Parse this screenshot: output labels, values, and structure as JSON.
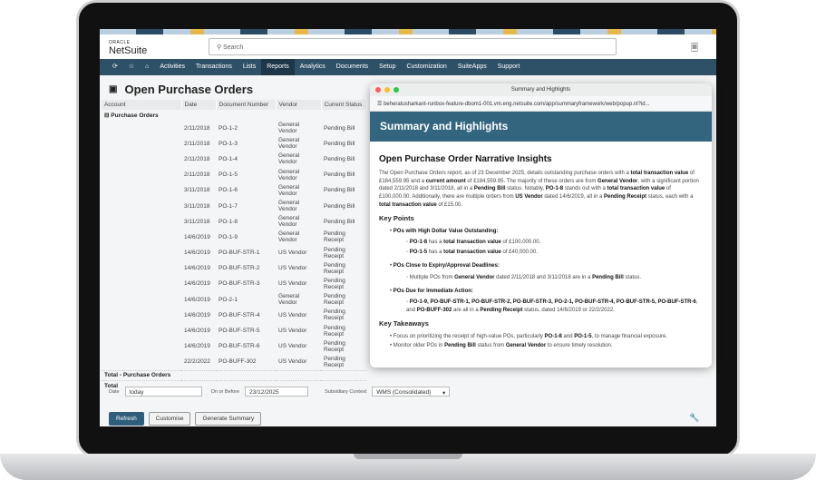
{
  "brand": {
    "top": "ORACLE",
    "name": "NetSuite"
  },
  "search": {
    "placeholder": "Search"
  },
  "nav": {
    "icons": [
      "history-icon",
      "star-icon",
      "home-icon"
    ],
    "items": [
      "Activities",
      "Transactions",
      "Lists",
      "Reports",
      "Analytics",
      "Documents",
      "Setup",
      "Customization",
      "SuiteApps",
      "Support"
    ],
    "active": "Reports"
  },
  "page": {
    "title": "Open Purchase Orders"
  },
  "table": {
    "columns": [
      "Account",
      "Date",
      "Document Number",
      "Vendor",
      "Current Status"
    ],
    "group": "Purchase Orders",
    "rows": [
      [
        "2/11/2018",
        "PO-1-2",
        "General Vendor",
        "Pending Bill"
      ],
      [
        "2/11/2018",
        "PO-1-3",
        "General Vendor",
        "Pending Bill"
      ],
      [
        "2/11/2018",
        "PO-1-4",
        "General Vendor",
        "Pending Bill"
      ],
      [
        "2/11/2018",
        "PO-1-5",
        "General Vendor",
        "Pending Bill"
      ],
      [
        "3/11/2018",
        "PO-1-6",
        "General Vendor",
        "Pending Bill"
      ],
      [
        "3/11/2018",
        "PO-1-7",
        "General Vendor",
        "Pending Bill"
      ],
      [
        "3/11/2018",
        "PO-1-8",
        "General Vendor",
        "Pending Bill"
      ],
      [
        "14/6/2019",
        "PO-1-9",
        "General Vendor",
        "Pending Receipt"
      ],
      [
        "14/6/2019",
        "PO-BUF-STR-1",
        "US Vendor",
        "Pending Receipt"
      ],
      [
        "14/6/2019",
        "PO-BUF-STR-2",
        "US Vendor",
        "Pending Receipt"
      ],
      [
        "14/6/2019",
        "PO-BUF-STR-3",
        "US Vendor",
        "Pending Receipt"
      ],
      [
        "14/6/2019",
        "PO-2-1",
        "General Vendor",
        "Pending Receipt"
      ],
      [
        "14/6/2019",
        "PO-BUF-STR-4",
        "US Vendor",
        "Pending Receipt"
      ],
      [
        "14/6/2019",
        "PO-BUF-STR-5",
        "US Vendor",
        "Pending Receipt"
      ],
      [
        "14/6/2019",
        "PO-BUF-STR-6",
        "US Vendor",
        "Pending Receipt"
      ],
      [
        "22/2/2022",
        "PO-BUFF-302",
        "US Vendor",
        "Pending Receipt"
      ]
    ],
    "group_total": "Total - Purchase Orders",
    "total": "Total"
  },
  "filters": {
    "date_label": "Date",
    "date_value": "today",
    "before_label": "On or Before",
    "before_value": "23/12/2025",
    "subsidiary_label": "Subsidiary Context",
    "subsidiary_value": "WMS (Consolidated)"
  },
  "buttons": {
    "refresh": "Refresh",
    "customise": "Customise",
    "generate": "Generate Summary"
  },
  "popup": {
    "window_title": "Summary and Highlights",
    "url": "beheratusharkant-runbox-feature-dbom1-001.vm.eng.netsuite.com/app/summaryframework/web/popup.nl?id...",
    "banner": "Summary and Highlights",
    "heading": "Open Purchase Order Narrative Insights",
    "intro": [
      {
        "t": "The Open Purchase Orders report, as of 23 December 2025, details outstanding purchase orders with a "
      },
      {
        "t": "total transaction value",
        "b": true
      },
      {
        "t": " of £184,559.95 and a "
      },
      {
        "t": "current amount",
        "b": true
      },
      {
        "t": " of £184,559.95. The majority of these orders are from "
      },
      {
        "t": "General Vendor",
        "b": true
      },
      {
        "t": ", with a significant portion dated 2/11/2018 and 3/11/2018, all in a "
      },
      {
        "t": "Pending Bill",
        "b": true
      },
      {
        "t": " status. Notably, "
      },
      {
        "t": "PO-1-8",
        "b": true
      },
      {
        "t": " stands out with a "
      },
      {
        "t": "total transaction value",
        "b": true
      },
      {
        "t": " of £100,000.00. Additionally, there are multiple orders from "
      },
      {
        "t": "US Vendor",
        "b": true
      },
      {
        "t": " dated 14/6/2019, all in a "
      },
      {
        "t": "Pending Receipt",
        "b": true
      },
      {
        "t": " status, each with a "
      },
      {
        "t": "total transaction value",
        "b": true
      },
      {
        "t": " of £15.00."
      }
    ],
    "key_points_title": "Key Points",
    "key_points": [
      {
        "title": "POs with High Dollar Value Outstanding:",
        "items": [
          [
            {
              "t": "PO-1-8",
              "b": true
            },
            {
              "t": " has a "
            },
            {
              "t": "total transaction value",
              "b": true
            },
            {
              "t": " of £100,000.00."
            }
          ],
          [
            {
              "t": "PO-1-5",
              "b": true
            },
            {
              "t": " has a "
            },
            {
              "t": "total transaction value",
              "b": true
            },
            {
              "t": " of £40,000.00."
            }
          ]
        ]
      },
      {
        "title": "POs Close to Expiry/Approval Deadlines:",
        "items": [
          [
            {
              "t": "Multiple POs from "
            },
            {
              "t": "General Vendor",
              "b": true
            },
            {
              "t": " dated 2/11/2018 and 3/11/2018 are in a "
            },
            {
              "t": "Pending Bill",
              "b": true
            },
            {
              "t": " status."
            }
          ]
        ]
      },
      {
        "title": "POs Due for Immediate Action:",
        "items": [
          [
            {
              "t": "PO-1-9, PO-BUF-STR-1, PO-BUF-STR-2, PO-BUF-STR-3, PO-2-1, PO-BUF-STR-4, PO-BUF-STR-5, PO-BUF-STR-6",
              "b": true
            },
            {
              "t": ", and "
            },
            {
              "t": "PO-BUFF-302",
              "b": true
            },
            {
              "t": " are all in a "
            },
            {
              "t": "Pending Receipt",
              "b": true
            },
            {
              "t": " status, dated 14/6/2019 or 22/2/2022."
            }
          ]
        ]
      }
    ],
    "takeaways_title": "Key Takeaways",
    "takeaways": [
      [
        {
          "t": "Focus on prioritizing the receipt of high-value POs, particularly "
        },
        {
          "t": "PO-1-8",
          "b": true
        },
        {
          "t": " and "
        },
        {
          "t": "PO-1-5",
          "b": true
        },
        {
          "t": ", to manage financial exposure."
        }
      ],
      [
        {
          "t": "Monitor older POs in "
        },
        {
          "t": "Pending Bill",
          "b": true
        },
        {
          "t": " status from "
        },
        {
          "t": "General Vendor",
          "b": true
        },
        {
          "t": " to ensure timely resolution."
        }
      ]
    ]
  },
  "colors": {
    "nav": "#2f5168",
    "banner": "#34657f",
    "primary_button": "#2f5d7c"
  }
}
